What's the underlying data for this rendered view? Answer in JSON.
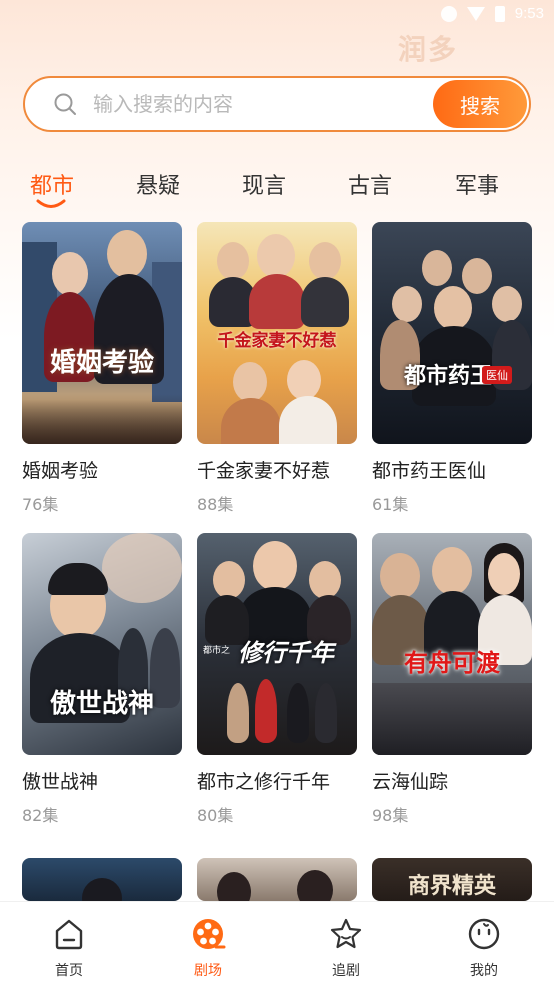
{
  "status_bar": {
    "time": "9:53"
  },
  "header": {
    "decoration_text": "润多"
  },
  "search": {
    "placeholder": "输入搜索的内容",
    "button_label": "搜索"
  },
  "tabs": [
    {
      "label": "都市",
      "active": true
    },
    {
      "label": "悬疑"
    },
    {
      "label": "现言"
    },
    {
      "label": "古言"
    },
    {
      "label": "军事"
    }
  ],
  "dramas": [
    {
      "title": "婚姻考验",
      "episodes": "76集",
      "poster_text": "婚姻考验"
    },
    {
      "title": "千金家妻不好惹",
      "episodes": "88集",
      "poster_text": "千金家妻不好惹"
    },
    {
      "title": "都市药王医仙",
      "episodes": "61集",
      "poster_text": "都市药王",
      "poster_badge": "医仙"
    },
    {
      "title": "傲世战神",
      "episodes": "82集",
      "poster_text": "傲世战神"
    },
    {
      "title": "都市之修行千年",
      "episodes": "80集",
      "poster_text": "修行千年",
      "poster_prefix": "都市之"
    },
    {
      "title": "云海仙踪",
      "episodes": "98集",
      "poster_text": "有舟可渡"
    }
  ],
  "partial_posters": [
    {
      "poster_text": ""
    },
    {
      "poster_text": ""
    },
    {
      "poster_text": "商界精英"
    }
  ],
  "bottom_nav": [
    {
      "label": "首页",
      "icon": "home-icon"
    },
    {
      "label": "剧场",
      "icon": "film-reel-icon",
      "active": true
    },
    {
      "label": "追剧",
      "icon": "star-icon"
    },
    {
      "label": "我的",
      "icon": "smile-face-icon"
    }
  ],
  "colors": {
    "accent": "#ff5a14",
    "search_border": "#f08a3c"
  }
}
